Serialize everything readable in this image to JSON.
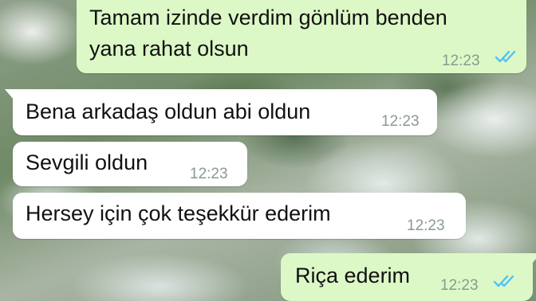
{
  "messages": [
    {
      "direction": "outgoing",
      "line1": "Tamam izinde verdim gönlüm benden",
      "line2": "yana rahat olsun",
      "time": "12:23",
      "status": "read"
    },
    {
      "direction": "incoming",
      "text": "Bena arkadaş oldun abi oldun",
      "time": "12:23"
    },
    {
      "direction": "incoming",
      "text": "Sevgili oldun",
      "time": "12:23"
    },
    {
      "direction": "incoming",
      "text": "Hersey için çok teşekkür ederim",
      "time": "12:23"
    },
    {
      "direction": "outgoing",
      "text": "Riça ederim",
      "time": "12:23",
      "status": "read"
    }
  ],
  "colors": {
    "outgoing_bubble": "#dcf8c6",
    "incoming_bubble": "#ffffff",
    "read_ticks": "#4fc3f7",
    "timestamp": "#8a9a90"
  },
  "icons": {
    "read_receipt": "double-check-icon"
  }
}
